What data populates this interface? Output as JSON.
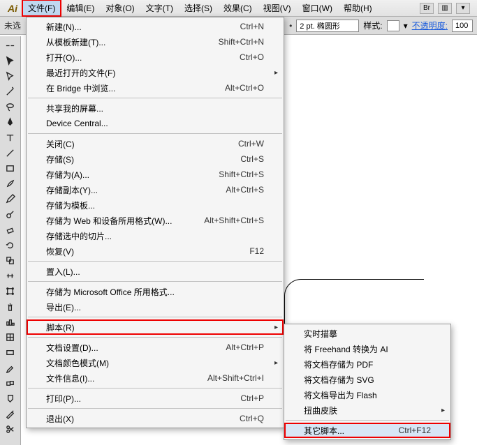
{
  "app_badge": "Ai",
  "menubar": {
    "items": [
      {
        "label": "文件(F)"
      },
      {
        "label": "编辑(E)"
      },
      {
        "label": "对象(O)"
      },
      {
        "label": "文字(T)"
      },
      {
        "label": "选择(S)"
      },
      {
        "label": "效果(C)"
      },
      {
        "label": "视图(V)"
      },
      {
        "label": "窗口(W)"
      },
      {
        "label": "帮助(H)"
      }
    ],
    "right": {
      "br": "Br",
      "grid": "▥",
      "dd": "▾"
    }
  },
  "secondbar": {
    "left_label": "未选",
    "stroke_value": "2 pt. 椭圆形",
    "style_label": "样式:",
    "opacity_label": "不透明度:",
    "opacity_value": "100"
  },
  "file_menu": [
    {
      "label": "新建(N)...",
      "shortcut": "Ctrl+N"
    },
    {
      "label": "从模板新建(T)...",
      "shortcut": "Shift+Ctrl+N"
    },
    {
      "label": "打开(O)...",
      "shortcut": "Ctrl+O"
    },
    {
      "label": "最近打开的文件(F)",
      "submenu": true
    },
    {
      "label": "在 Bridge 中浏览...",
      "shortcut": "Alt+Ctrl+O"
    },
    {
      "sep": true
    },
    {
      "label": "共享我的屏幕..."
    },
    {
      "label": "Device Central..."
    },
    {
      "sep": true
    },
    {
      "label": "关闭(C)",
      "shortcut": "Ctrl+W"
    },
    {
      "label": "存储(S)",
      "shortcut": "Ctrl+S"
    },
    {
      "label": "存储为(A)...",
      "shortcut": "Shift+Ctrl+S"
    },
    {
      "label": "存储副本(Y)...",
      "shortcut": "Alt+Ctrl+S"
    },
    {
      "label": "存储为模板..."
    },
    {
      "label": "存储为 Web 和设备所用格式(W)...",
      "shortcut": "Alt+Shift+Ctrl+S"
    },
    {
      "label": "存储选中的切片..."
    },
    {
      "label": "恢复(V)",
      "shortcut": "F12"
    },
    {
      "sep": true
    },
    {
      "label": "置入(L)..."
    },
    {
      "sep": true
    },
    {
      "label": "存储为 Microsoft Office 所用格式..."
    },
    {
      "label": "导出(E)..."
    },
    {
      "sep": true
    },
    {
      "label": "脚本(R)",
      "submenu": true,
      "highlight": true
    },
    {
      "sep": true
    },
    {
      "label": "文档设置(D)...",
      "shortcut": "Alt+Ctrl+P"
    },
    {
      "label": "文档颜色模式(M)",
      "submenu": true
    },
    {
      "label": "文件信息(I)...",
      "shortcut": "Alt+Shift+Ctrl+I"
    },
    {
      "sep": true
    },
    {
      "label": "打印(P)...",
      "shortcut": "Ctrl+P"
    },
    {
      "sep": true
    },
    {
      "label": "退出(X)",
      "shortcut": "Ctrl+Q"
    }
  ],
  "script_submenu": [
    {
      "label": "实时描摹"
    },
    {
      "label": "将 Freehand 转换为 AI"
    },
    {
      "label": "将文档存储为 PDF"
    },
    {
      "label": "将文档存储为 SVG"
    },
    {
      "label": "将文档导出为 Flash"
    },
    {
      "label": "扭曲皮肤",
      "submenu": true
    },
    {
      "sep": true
    },
    {
      "label": "其它脚本...",
      "shortcut": "Ctrl+F12",
      "highlight": true
    }
  ],
  "tool_icons": [
    "two-col",
    "selection",
    "direct-select",
    "wand",
    "lasso",
    "pen",
    "type",
    "line",
    "rect",
    "brush",
    "pencil",
    "blob",
    "eraser",
    "rotate",
    "scale",
    "warp",
    "free",
    "symbol",
    "column",
    "mesh",
    "gradient",
    "eyedrop",
    "blend",
    "live",
    "slice",
    "scissors",
    "hand"
  ]
}
